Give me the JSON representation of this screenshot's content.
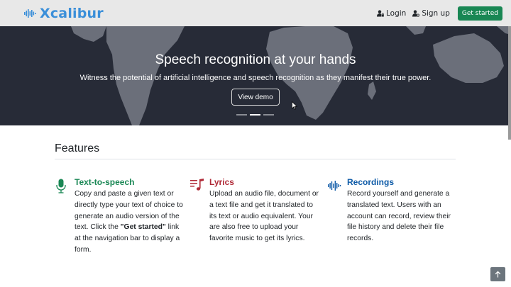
{
  "navbar": {
    "brand": "Xcalibur",
    "login": "Login",
    "signup": "Sign up",
    "get_started": "Get started"
  },
  "hero": {
    "title": "Speech recognition at your hands",
    "subtitle": "Witness the potential of artificial intelligence and speech recognition as they manifest their true power.",
    "cta": "View demo",
    "slides": 3,
    "active_slide": 2
  },
  "features": {
    "title": "Features",
    "items": [
      {
        "title": "Text-to-speech",
        "icon": "microphone-icon",
        "color": "#198754",
        "desc_pre": "Copy and paste a given text or directly type your text of choice to generate an audio version of the text. Click the ",
        "desc_bold": "\"Get started\"",
        "desc_post": " link at the navigation bar to display a form."
      },
      {
        "title": "Lyrics",
        "icon": "music-list-icon",
        "color": "#b02a37",
        "description": "Upload an audio file, document or a text file and get it translated to its text or audio equivalent. Your are also free to upload your favorite music to get its lyrics."
      },
      {
        "title": "Recordings",
        "icon": "soundwave-icon",
        "color": "#0d5aa7",
        "description": "Record yourself and generate a translated text. Users with an account can record, review their file history and delete their file records."
      }
    ]
  },
  "colors": {
    "brand": "#3b8fd9",
    "hero_bg": "#272b37",
    "success": "#198754"
  }
}
